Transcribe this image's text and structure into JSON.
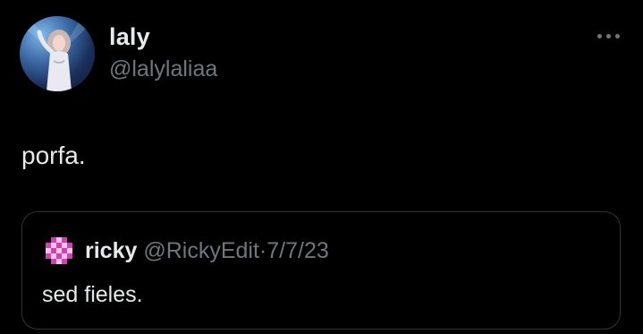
{
  "post": {
    "author": {
      "display_name": "laly",
      "handle": "@lalylaliaa",
      "avatar_icon": "profile-photo"
    },
    "text": "porfa.",
    "more_icon": "ellipsis-icon"
  },
  "quoted_post": {
    "author": {
      "display_name": "ricky",
      "handle": "@RickyEdit",
      "avatar_icon": "pink-checkered-avatar"
    },
    "separator": "·",
    "date": "7/7/23",
    "text": "sed fieles."
  },
  "colors": {
    "background": "#000000",
    "primary_text": "#e7e9ea",
    "secondary_text": "#71767b",
    "border": "#2f3336",
    "avatar_accent": "#d63fb0"
  }
}
